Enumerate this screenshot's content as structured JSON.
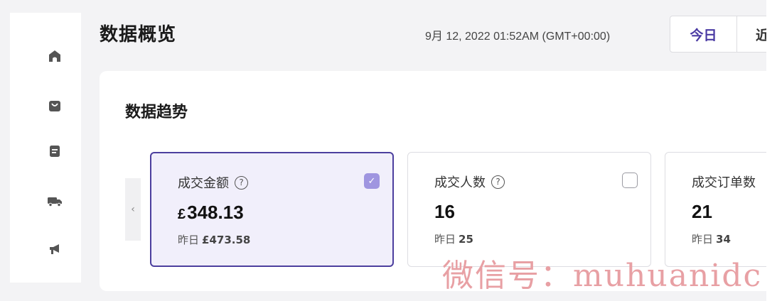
{
  "header": {
    "title": "数据概览",
    "timestamp": "9月 12, 2022 01:52AM (GMT+00:00)",
    "ranges": [
      {
        "label": "今日",
        "active": true
      },
      {
        "label": "近",
        "active": false
      }
    ]
  },
  "sidebar": {
    "icons": [
      "home-icon",
      "shopping-bag-icon",
      "document-icon",
      "truck-icon",
      "megaphone-icon"
    ]
  },
  "section": {
    "title": "数据趋势",
    "prev_arrow": "‹"
  },
  "cards": [
    {
      "label": "成交金额",
      "currency": "£",
      "value": "348.13",
      "prev_label": "昨日",
      "prev_value": "£473.58",
      "selected": true,
      "help": "?"
    },
    {
      "label": "成交人数",
      "currency": "",
      "value": "16",
      "prev_label": "昨日",
      "prev_value": "25",
      "selected": false,
      "help": "?"
    },
    {
      "label": "成交订单数",
      "currency": "",
      "value": "21",
      "prev_label": "昨日",
      "prev_value": "34",
      "selected": false
    }
  ],
  "watermark": "微信号：muhuanidc",
  "colors": {
    "accent": "#4c3f9e",
    "selected_bg": "#f1effb",
    "checkbox_checked": "#9f95e0",
    "page_bg": "#f3f3f5",
    "watermark": "#e8a0a4"
  }
}
